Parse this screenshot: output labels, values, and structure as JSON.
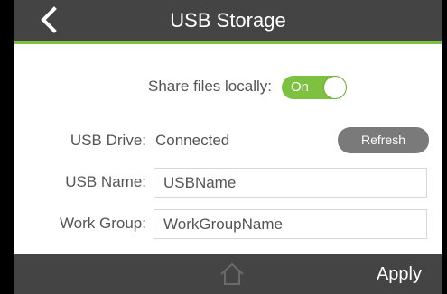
{
  "header": {
    "title": "USB Storage",
    "back_icon": "chevron-left-icon"
  },
  "share": {
    "label": "Share files locally:",
    "toggle_text": "On",
    "toggle_state": "on"
  },
  "usb_drive": {
    "label": "USB Drive:",
    "status": "Connected",
    "refresh_label": "Refresh"
  },
  "usb_name": {
    "label": "USB Name:",
    "value": "USBName"
  },
  "work_group": {
    "label": "Work Group:",
    "value": "WorkGroupName"
  },
  "footer": {
    "home_icon": "home-icon",
    "apply_label": "Apply"
  },
  "colors": {
    "header_bg": "#444444",
    "accent_green": "#7cc140",
    "button_gray": "#7a7a7a",
    "text_gray": "#555555"
  }
}
